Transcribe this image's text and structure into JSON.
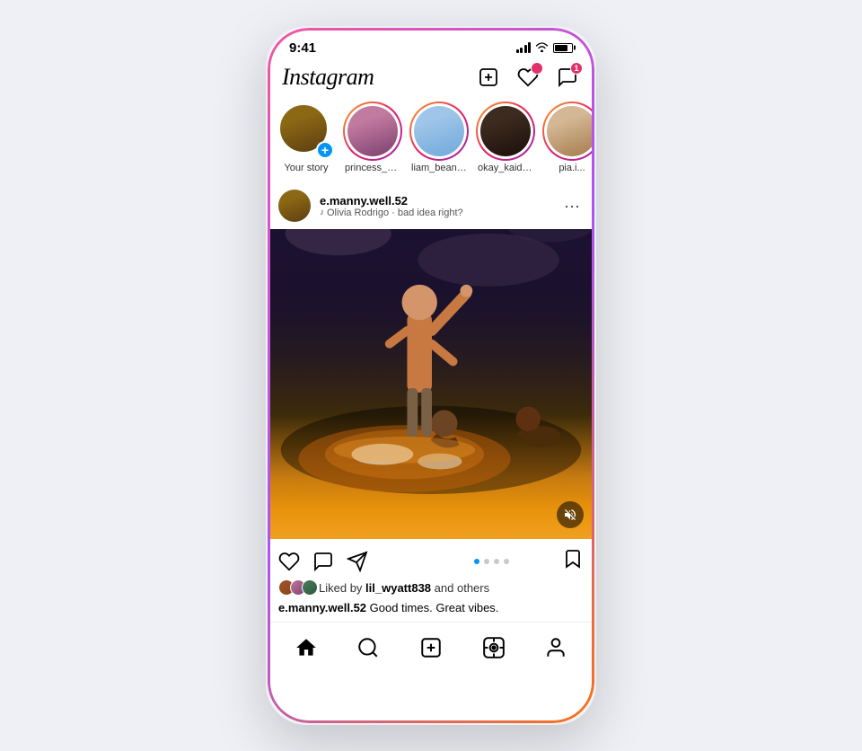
{
  "phone": {
    "status_bar": {
      "time": "9:41",
      "battery_level": "80"
    },
    "header": {
      "logo": "Instagram",
      "add_label": "Add",
      "likes_label": "Notifications",
      "messages_label": "Messages",
      "messages_badge": "1"
    },
    "stories": [
      {
        "id": "your-story",
        "label": "Your story",
        "has_ring": false,
        "has_add": true,
        "color_class": "avatar-face-1"
      },
      {
        "id": "princess_p",
        "label": "princess_p...",
        "has_ring": true,
        "has_add": false,
        "color_class": "avatar-face-2"
      },
      {
        "id": "liam_beanz",
        "label": "liam_beanz...",
        "has_ring": true,
        "has_add": false,
        "color_class": "avatar-face-3"
      },
      {
        "id": "okay_kaide",
        "label": "okay_kaide...",
        "has_ring": true,
        "has_add": false,
        "color_class": "avatar-face-4"
      },
      {
        "id": "pia",
        "label": "pia.i...",
        "has_ring": true,
        "has_add": false,
        "color_class": "avatar-face-5"
      }
    ],
    "post": {
      "username": "e.manny.well.52",
      "music": "Olivia Rodrigo · bad idea right?",
      "liked_by_user": "lil_wyatt838",
      "liked_by_others": "and others",
      "caption_user": "e.manny.well.52",
      "caption_text": " Good times. Great vibes.",
      "dots": [
        true,
        false,
        false,
        false
      ]
    },
    "nav": {
      "home_label": "Home",
      "search_label": "Search",
      "create_label": "Create",
      "reels_label": "Reels",
      "profile_label": "Profile"
    }
  }
}
